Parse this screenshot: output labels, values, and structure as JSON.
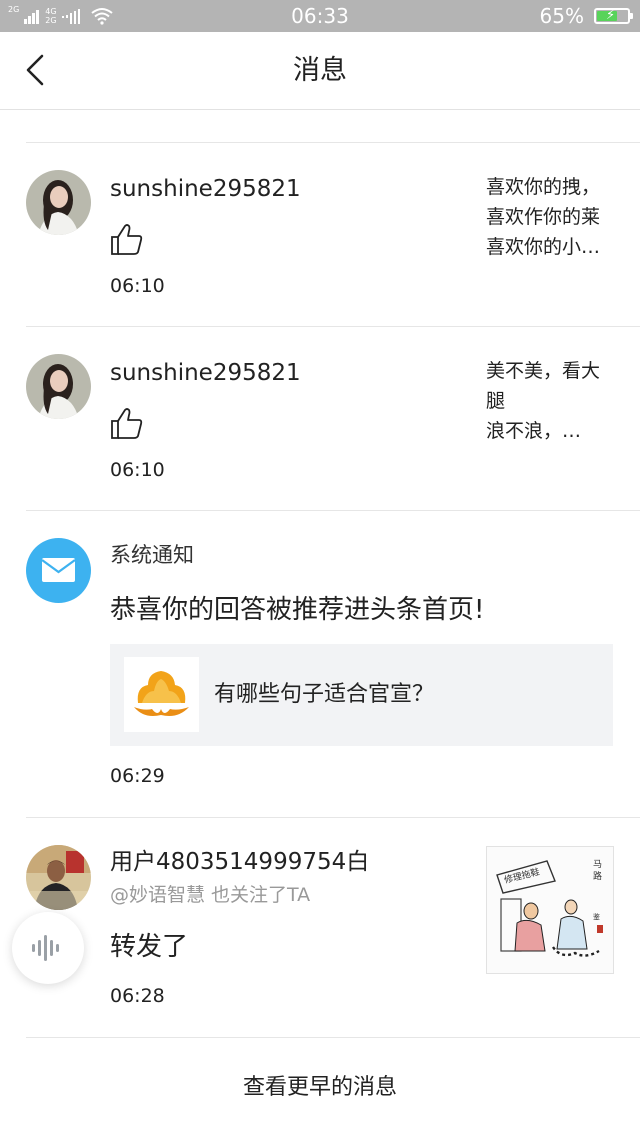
{
  "status_bar": {
    "network_left": "2G",
    "network_right_top": "4G",
    "network_right_bottom": "2G",
    "time": "06:33",
    "battery_text": "65%",
    "battery_level": 0.65,
    "battery_color": "#58d35a"
  },
  "nav": {
    "title": "消息",
    "back_icon": "chevron-left-icon"
  },
  "messages": [
    {
      "type": "like",
      "username": "sunshine295821",
      "time": "06:10",
      "action_icon": "thumbs-up-icon",
      "quote_lines": [
        "喜欢你的拽，",
        "喜欢作你的莱",
        "喜欢你的小…"
      ]
    },
    {
      "type": "like",
      "username": "sunshine295821",
      "time": "06:10",
      "action_icon": "thumbs-up-icon",
      "quote_lines": [
        "美不美，看大",
        "腿",
        "浪不浪，…"
      ]
    },
    {
      "type": "system",
      "label": "系统通知",
      "text": "恭喜你的回答被推荐进头条首页!",
      "card_text": "有哪些句子适合官宣？",
      "time": "06:29",
      "icon": "mail-icon",
      "icon_color": "#3db2f0"
    },
    {
      "type": "forward",
      "username": "用户4803514999754白",
      "sub": "@妙语智慧 也关注了TA",
      "text": "转发了",
      "time": "06:28"
    }
  ],
  "footer": {
    "more_label": "查看更早的消息"
  },
  "floating": {
    "voice_icon": "voice-waveform-icon"
  }
}
